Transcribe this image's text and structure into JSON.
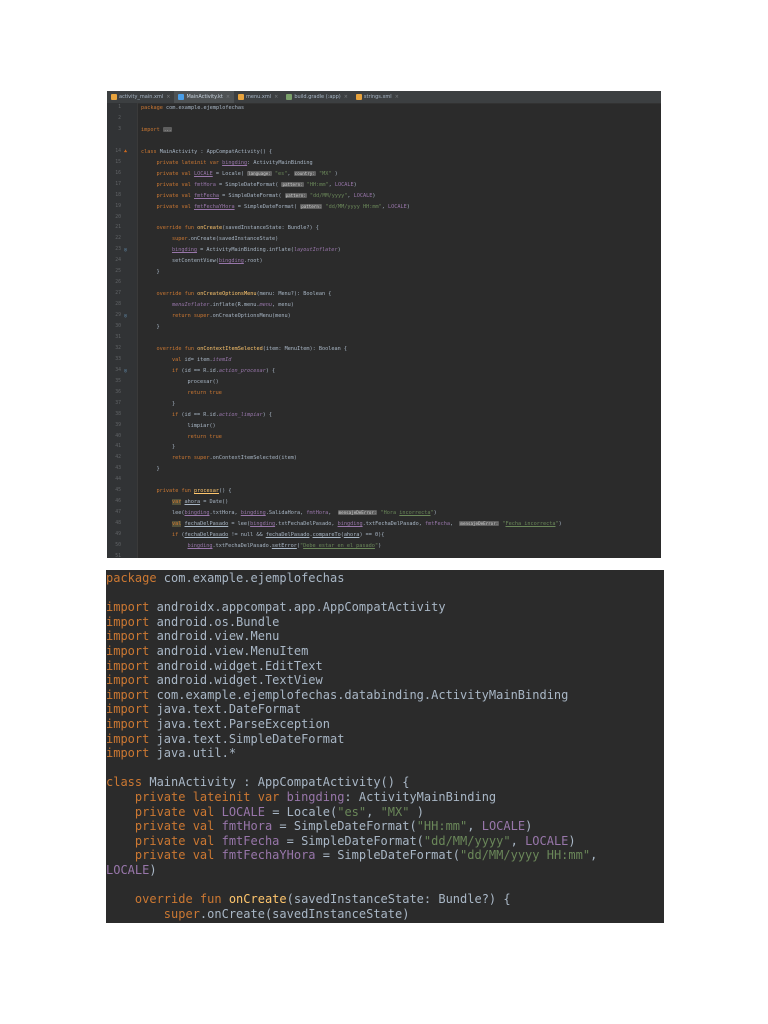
{
  "tabs": [
    {
      "label": "activity_main.xml",
      "icon_color": "#e8a33d",
      "active": false
    },
    {
      "label": "MainActivity.kt",
      "icon_color": "#4a9ee8",
      "active": true
    },
    {
      "label": "menu.xml",
      "icon_color": "#e8a33d",
      "active": false
    },
    {
      "label": "build.gradle (:app)",
      "icon_color": "#7aa06a",
      "active": false
    },
    {
      "label": "strings.xml",
      "icon_color": "#e8a33d",
      "active": false
    }
  ],
  "tab_close_glyph": "×",
  "gutter": {
    "line_numbers": [
      "1",
      "2",
      "3",
      "",
      "14",
      "15",
      "16",
      "17",
      "18",
      "19",
      "20",
      "21",
      "22",
      "23",
      "24",
      "25",
      "26",
      "27",
      "28",
      "29",
      "30",
      "31",
      "32",
      "33",
      "34",
      "35",
      "36",
      "37",
      "38",
      "39",
      "40",
      "41",
      "42",
      "43",
      "44",
      "45",
      "46",
      "47",
      "48",
      "49",
      "50",
      "51"
    ],
    "icons": [
      {
        "row": 4,
        "name": "class-icon",
        "glyph": "♣",
        "color": "#d16a1d"
      },
      {
        "row": 13,
        "name": "override-icon",
        "glyph": "◎",
        "color": "#6897bb"
      },
      {
        "row": 19,
        "name": "override-icon",
        "glyph": "◎",
        "color": "#6897bb"
      },
      {
        "row": 24,
        "name": "override-icon",
        "glyph": "◎",
        "color": "#6897bb"
      }
    ]
  },
  "ide_code": {
    "lines": [
      {
        "indent": 0,
        "tokens": [
          [
            "k",
            "package "
          ],
          [
            "",
            "com.example.ejemplofechas"
          ]
        ]
      },
      {
        "indent": 0,
        "tokens": []
      },
      {
        "indent": 0,
        "tokens": [
          [
            "k",
            "import "
          ],
          [
            "h",
            "..."
          ]
        ]
      },
      {
        "indent": 0,
        "tokens": []
      },
      {
        "indent": 0,
        "tokens": [
          [
            "k",
            "class "
          ],
          [
            "",
            "MainActivity : AppCompatActivity() {"
          ]
        ]
      },
      {
        "indent": 1,
        "tokens": [
          [
            "k",
            "private lateinit var "
          ],
          [
            "pu",
            "bingding"
          ],
          [
            "",
            ": ActivityMainBinding"
          ]
        ]
      },
      {
        "indent": 1,
        "tokens": [
          [
            "k",
            "private val "
          ],
          [
            "pu",
            "LOCALE"
          ],
          [
            "",
            " = Locale( "
          ],
          [
            "h",
            "language:"
          ],
          [
            "s",
            " \"es\""
          ],
          [
            "",
            ", "
          ],
          [
            "h",
            "country:"
          ],
          [
            "s",
            " \"MX\""
          ],
          [
            "",
            " )"
          ]
        ]
      },
      {
        "indent": 1,
        "tokens": [
          [
            "k",
            "private val "
          ],
          [
            "p",
            "fmtHora"
          ],
          [
            "",
            " = SimpleDateFormat( "
          ],
          [
            "h",
            "pattern:"
          ],
          [
            "s",
            " \"HH:mm\""
          ],
          [
            "",
            ", "
          ],
          [
            "p",
            "LOCALE"
          ],
          [
            "",
            ")"
          ]
        ]
      },
      {
        "indent": 1,
        "tokens": [
          [
            "k",
            "private val "
          ],
          [
            "pu",
            "fmtFecha"
          ],
          [
            "",
            " = SimpleDateFormat( "
          ],
          [
            "h",
            "pattern:"
          ],
          [
            "s",
            " \"dd/MM/yyyy\""
          ],
          [
            "",
            ", "
          ],
          [
            "p",
            "LOCALE"
          ],
          [
            "",
            ")"
          ]
        ]
      },
      {
        "indent": 1,
        "tokens": [
          [
            "k",
            "private val "
          ],
          [
            "pu",
            "fmtFechaYHora"
          ],
          [
            "",
            " = SimpleDateFormat( "
          ],
          [
            "h",
            "pattern:"
          ],
          [
            "s",
            " \"dd/MM/yyyy HH:mm\""
          ],
          [
            "",
            ", "
          ],
          [
            "p",
            "LOCALE"
          ],
          [
            "",
            ")"
          ]
        ]
      },
      {
        "indent": 0,
        "tokens": []
      },
      {
        "indent": 1,
        "tokens": [
          [
            "k",
            "override fun "
          ],
          [
            "f",
            "onCreate"
          ],
          [
            "",
            "(savedInstanceState: Bundle?) {"
          ]
        ]
      },
      {
        "indent": 2,
        "tokens": [
          [
            "k",
            "super"
          ],
          [
            "",
            ".onCreate(savedInstanceState)"
          ]
        ]
      },
      {
        "indent": 2,
        "tokens": [
          [
            "pu",
            "bingding"
          ],
          [
            "",
            " = ActivityMainBinding.inflate("
          ],
          [
            "it",
            "layoutInflater"
          ],
          [
            "",
            ")"
          ]
        ]
      },
      {
        "indent": 2,
        "tokens": [
          [
            "",
            "setContentView("
          ],
          [
            "pu",
            "bingding"
          ],
          [
            "",
            ".root)"
          ]
        ]
      },
      {
        "indent": 1,
        "tokens": [
          [
            "",
            "}"
          ]
        ]
      },
      {
        "indent": 0,
        "tokens": []
      },
      {
        "indent": 1,
        "tokens": [
          [
            "k",
            "override fun "
          ],
          [
            "f",
            "onCreateOptionsMenu"
          ],
          [
            "",
            "(menu: Menu?): Boolean {"
          ]
        ]
      },
      {
        "indent": 2,
        "tokens": [
          [
            "it",
            "menuInflater"
          ],
          [
            "",
            ".inflate(R.menu."
          ],
          [
            "it",
            "menu"
          ],
          [
            "",
            ", menu)"
          ]
        ]
      },
      {
        "indent": 2,
        "tokens": [
          [
            "k",
            "return super"
          ],
          [
            "",
            ".onCreateOptionsMenu(menu)"
          ]
        ]
      },
      {
        "indent": 1,
        "tokens": [
          [
            "",
            "}"
          ]
        ]
      },
      {
        "indent": 0,
        "tokens": []
      },
      {
        "indent": 1,
        "tokens": [
          [
            "k",
            "override fun "
          ],
          [
            "f",
            "onContextItemSelected"
          ],
          [
            "",
            "(item: MenuItem): Boolean {"
          ]
        ]
      },
      {
        "indent": 2,
        "tokens": [
          [
            "k",
            "val "
          ],
          [
            "",
            "id= item."
          ],
          [
            "it",
            "itemId"
          ]
        ]
      },
      {
        "indent": 2,
        "tokens": [
          [
            "k",
            "if "
          ],
          [
            "",
            "(id == R.id."
          ],
          [
            "it",
            "action_procesar"
          ],
          [
            "",
            ") {"
          ]
        ]
      },
      {
        "indent": 3,
        "tokens": [
          [
            "",
            "procesar()"
          ]
        ]
      },
      {
        "indent": 3,
        "tokens": [
          [
            "k",
            "return true"
          ]
        ]
      },
      {
        "indent": 2,
        "tokens": [
          [
            "",
            "}"
          ]
        ]
      },
      {
        "indent": 2,
        "tokens": [
          [
            "k",
            "if "
          ],
          [
            "",
            "(id == R.id."
          ],
          [
            "it",
            "action_limpiar"
          ],
          [
            "",
            ") {"
          ]
        ]
      },
      {
        "indent": 3,
        "tokens": [
          [
            "",
            "limpiar()"
          ]
        ]
      },
      {
        "indent": 3,
        "tokens": [
          [
            "k",
            "return true"
          ]
        ]
      },
      {
        "indent": 2,
        "tokens": [
          [
            "",
            "}"
          ]
        ]
      },
      {
        "indent": 2,
        "tokens": [
          [
            "k",
            "return super"
          ],
          [
            "",
            ".onContextItemSelected(item)"
          ]
        ]
      },
      {
        "indent": 1,
        "tokens": [
          [
            "",
            "}"
          ]
        ]
      },
      {
        "indent": 0,
        "tokens": []
      },
      {
        "indent": 1,
        "tokens": [
          [
            "k",
            "private fun "
          ],
          [
            "fu",
            "procesar"
          ],
          [
            "",
            "() {"
          ]
        ]
      },
      {
        "indent": 2,
        "tokens": [
          [
            "kv",
            "var"
          ],
          [
            "",
            " "
          ],
          [
            "u",
            "ahora"
          ],
          [
            "",
            " = Date()"
          ]
        ]
      },
      {
        "indent": 2,
        "tokens": [
          [
            "",
            "lee("
          ],
          [
            "pu",
            "bingding"
          ],
          [
            "",
            ".txtHora, "
          ],
          [
            "pu",
            "bingding"
          ],
          [
            "",
            ".SalidaHora, "
          ],
          [
            "p",
            "fmtHora"
          ],
          [
            "",
            ",  "
          ],
          [
            "h",
            "mensajeDeError:"
          ],
          [
            "s",
            " \"Hora "
          ],
          [
            "su",
            "incorrecta"
          ],
          [
            "s",
            "\""
          ],
          [
            "",
            ")"
          ]
        ]
      },
      {
        "indent": 2,
        "tokens": [
          [
            "kv",
            "val"
          ],
          [
            "",
            " "
          ],
          [
            "u",
            "fechaDelPasado"
          ],
          [
            "",
            " = lee("
          ],
          [
            "pu",
            "bingding"
          ],
          [
            "",
            ".txtFechaDelPasado, "
          ],
          [
            "pu",
            "bingding"
          ],
          [
            "",
            ".txtFechaDelPasado, "
          ],
          [
            "p",
            "fmtFecha"
          ],
          [
            "",
            ",  "
          ],
          [
            "h",
            "mensajeDeError:"
          ],
          [
            "s",
            " \""
          ],
          [
            "su",
            "Fecha incorrecta"
          ],
          [
            "s",
            "\""
          ],
          [
            "",
            ")"
          ]
        ]
      },
      {
        "indent": 2,
        "tokens": [
          [
            "k",
            "if "
          ],
          [
            "",
            "("
          ],
          [
            "u",
            "fechaDelPasado"
          ],
          [
            "",
            " != null && "
          ],
          [
            "u",
            "fechaDelPasado"
          ],
          [
            "",
            "."
          ],
          [
            "u",
            "compareTo"
          ],
          [
            "",
            "("
          ],
          [
            "u",
            "ahora"
          ],
          [
            "",
            ") == 0){"
          ]
        ]
      },
      {
        "indent": 3,
        "tokens": [
          [
            "pu",
            "bingding"
          ],
          [
            "",
            ".txtFechaDelPasado."
          ],
          [
            "u",
            "setError"
          ],
          [
            "",
            "("
          ],
          [
            "s",
            "\""
          ],
          [
            "su",
            "Debe estar en el pasado"
          ],
          [
            "s",
            "\""
          ],
          [
            "",
            ")"
          ]
        ]
      }
    ]
  },
  "snippet": {
    "lines": [
      {
        "tokens": [
          [
            "k",
            "package "
          ],
          [
            "",
            "com.example.ejemplofechas"
          ]
        ]
      },
      {
        "tokens": []
      },
      {
        "tokens": [
          [
            "k",
            "import "
          ],
          [
            "",
            "androidx.appcompat.app.AppCompatActivity"
          ]
        ]
      },
      {
        "tokens": [
          [
            "k",
            "import "
          ],
          [
            "",
            "android.os.Bundle"
          ]
        ]
      },
      {
        "tokens": [
          [
            "k",
            "import "
          ],
          [
            "",
            "android.view.Menu"
          ]
        ]
      },
      {
        "tokens": [
          [
            "k",
            "import "
          ],
          [
            "",
            "android.view.MenuItem"
          ]
        ]
      },
      {
        "tokens": [
          [
            "k",
            "import "
          ],
          [
            "",
            "android.widget.EditText"
          ]
        ]
      },
      {
        "tokens": [
          [
            "k",
            "import "
          ],
          [
            "",
            "android.widget.TextView"
          ]
        ]
      },
      {
        "tokens": [
          [
            "k",
            "import "
          ],
          [
            "",
            "com.example.ejemplofechas.databinding.ActivityMainBinding"
          ]
        ]
      },
      {
        "tokens": [
          [
            "k",
            "import "
          ],
          [
            "",
            "java.text.DateFormat"
          ]
        ]
      },
      {
        "tokens": [
          [
            "k",
            "import "
          ],
          [
            "",
            "java.text.ParseException"
          ]
        ]
      },
      {
        "tokens": [
          [
            "k",
            "import "
          ],
          [
            "",
            "java.text.SimpleDateFormat"
          ]
        ]
      },
      {
        "tokens": [
          [
            "k",
            "import "
          ],
          [
            "",
            "java.util.*"
          ]
        ]
      },
      {
        "tokens": []
      },
      {
        "tokens": [
          [
            "k",
            "class "
          ],
          [
            "",
            "MainActivity : AppCompatActivity() {"
          ]
        ]
      },
      {
        "tokens": [
          [
            "",
            "    "
          ],
          [
            "k",
            "private lateinit var "
          ],
          [
            "p",
            "bingding"
          ],
          [
            "",
            ": ActivityMainBinding"
          ]
        ]
      },
      {
        "tokens": [
          [
            "",
            "    "
          ],
          [
            "k",
            "private val "
          ],
          [
            "p",
            "LOCALE"
          ],
          [
            "",
            " = Locale("
          ],
          [
            "s",
            "\"es\""
          ],
          [
            "",
            ", "
          ],
          [
            "s",
            "\"MX\""
          ],
          [
            "",
            " )"
          ]
        ]
      },
      {
        "tokens": [
          [
            "",
            "    "
          ],
          [
            "k",
            "private val "
          ],
          [
            "p",
            "fmtHora"
          ],
          [
            "",
            " = SimpleDateFormat("
          ],
          [
            "s",
            "\"HH:mm\""
          ],
          [
            "",
            ", "
          ],
          [
            "p",
            "LOCALE"
          ],
          [
            "",
            ")"
          ]
        ]
      },
      {
        "tokens": [
          [
            "",
            "    "
          ],
          [
            "k",
            "private val "
          ],
          [
            "p",
            "fmtFecha"
          ],
          [
            "",
            " = SimpleDateFormat("
          ],
          [
            "s",
            "\"dd/MM/yyyy\""
          ],
          [
            "",
            ", "
          ],
          [
            "p",
            "LOCALE"
          ],
          [
            "",
            ")"
          ]
        ]
      },
      {
        "tokens": [
          [
            "",
            "    "
          ],
          [
            "k",
            "private val "
          ],
          [
            "p",
            "fmtFechaYHora"
          ],
          [
            "",
            " = SimpleDateFormat("
          ],
          [
            "s",
            "\"dd/MM/yyyy HH:mm\""
          ],
          [
            "",
            ","
          ]
        ]
      },
      {
        "tokens": [
          [
            "p",
            "LOCALE"
          ],
          [
            "",
            ")"
          ]
        ]
      },
      {
        "tokens": []
      },
      {
        "tokens": [
          [
            "",
            "    "
          ],
          [
            "k",
            "override fun "
          ],
          [
            "f",
            "onCreate"
          ],
          [
            "",
            "(savedInstanceState: Bundle?) {"
          ]
        ]
      },
      {
        "tokens": [
          [
            "",
            "        "
          ],
          [
            "k",
            "super"
          ],
          [
            "",
            ".onCreate(savedInstanceState)"
          ]
        ]
      }
    ]
  }
}
